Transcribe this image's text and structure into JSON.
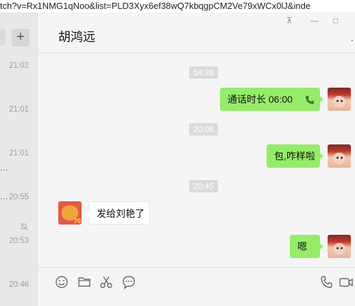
{
  "browser": {
    "url_fragment": "tch?v=Rx1NMG1qNoo&list=PLD3Xyx6ef38wQ7kbqgpCM2Ve79xWCx0lJ&inde"
  },
  "sidebar": {
    "add_label": "+",
    "times": [
      "21:02",
      "21:01",
      "21:01",
      "20:55",
      "20:53",
      "20:46"
    ],
    "dots": [
      "...",
      "..."
    ]
  },
  "chat": {
    "title": "胡鸿远",
    "window_controls": {
      "pin": "⊼",
      "minimize": "—",
      "maximize": "□"
    },
    "more": "·",
    "messages": [
      {
        "type": "timestamp",
        "text": "14:28"
      },
      {
        "type": "call",
        "from": "me",
        "text": "通话时长 06:00"
      },
      {
        "type": "timestamp",
        "text": "20:06"
      },
      {
        "type": "text",
        "from": "me",
        "text": "包,咋样啦"
      },
      {
        "type": "timestamp",
        "text": "20:45"
      },
      {
        "type": "text",
        "from": "them",
        "text": "发给刘艳了"
      },
      {
        "type": "text",
        "from": "me",
        "text": "嗯"
      }
    ],
    "avatar_badge": "70"
  },
  "toolbar": {
    "icons": [
      "emoji-icon",
      "folder-icon",
      "scissors-icon",
      "chat-bubble-icon",
      "phone-icon",
      "video-icon"
    ]
  },
  "colors": {
    "my_bubble": "#95ec69",
    "their_bubble": "#ffffff",
    "timestamp_bg": "#dadada"
  }
}
